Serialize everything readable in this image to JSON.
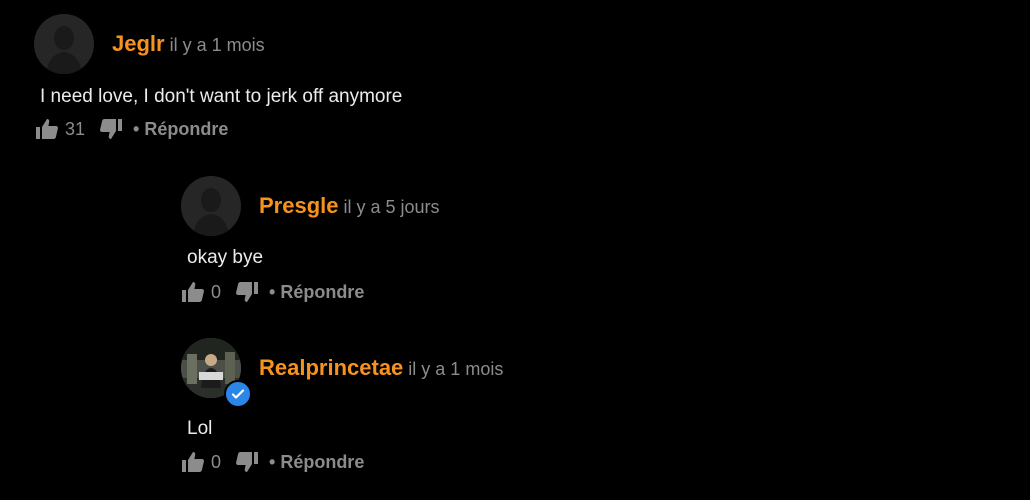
{
  "comments": [
    {
      "username": "Jeglr",
      "time": "il y a 1 mois",
      "text": "I need love, I don't want to jerk off anymore",
      "likes": "31",
      "reply_label": "• Répondre",
      "avatar": "default-avatar"
    },
    {
      "username": "Presgle",
      "time": "il y a 5 jours",
      "text": "okay bye",
      "likes": "0",
      "reply_label": "• Répondre",
      "avatar": "default-avatar"
    },
    {
      "username": "Realprincetae",
      "time": "il y a 1 mois",
      "text": "Lol",
      "likes": "0",
      "reply_label": "• Répondre",
      "avatar": "user-photo",
      "verified": true
    }
  ],
  "colors": {
    "username": "#f7921e",
    "meta": "#8c8c8c",
    "verified": "#2a86e8"
  }
}
